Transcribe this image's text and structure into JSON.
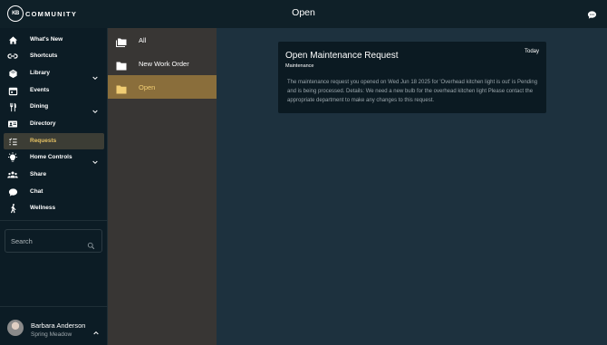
{
  "header": {
    "logo_badge": "KB",
    "logo_text": "COMMUNITY",
    "title": "Open"
  },
  "sidebar": {
    "items": [
      {
        "label": "What's New",
        "icon": "home-icon"
      },
      {
        "label": "Shortcuts",
        "icon": "link-icon"
      },
      {
        "label": "Library",
        "icon": "library-icon"
      },
      {
        "label": "Events",
        "icon": "calendar-icon"
      },
      {
        "label": "Dining",
        "icon": "dining-icon"
      },
      {
        "label": "Directory",
        "icon": "directory-icon"
      },
      {
        "label": "Requests",
        "icon": "requests-icon"
      },
      {
        "label": "Home Controls",
        "icon": "lightbulb-icon"
      },
      {
        "label": "Share",
        "icon": "people-icon"
      },
      {
        "label": "Chat",
        "icon": "chat-icon"
      },
      {
        "label": "Wellness",
        "icon": "walking-icon"
      }
    ],
    "active_item": "Requests",
    "search_placeholder": "Search",
    "user": {
      "name": "Barbara Anderson",
      "community": "Spring Meadow"
    }
  },
  "folders": {
    "items": [
      {
        "label": "All",
        "icon": "folders-icon"
      },
      {
        "label": "New Work Order",
        "icon": "folder-icon"
      },
      {
        "label": "Open",
        "icon": "folder-icon"
      }
    ],
    "active_item": "Open"
  },
  "request": {
    "title": "Open Maintenance Request",
    "date": "Today",
    "category": "Maintenance",
    "body": "The maintenance request you opened on Wed Jun 18 2025 for 'Overhead kitchen light is out' is Pending and is being processed. Details: We need a new bulb for the overhead kitchen light Please contact the appropriate department to make any changes to this request."
  },
  "colors": {
    "accent": "#e5c163",
    "active_folder": "#8a6e3b",
    "sidebar_bg": "#0c1c25",
    "content_bg": "#1d313e"
  }
}
